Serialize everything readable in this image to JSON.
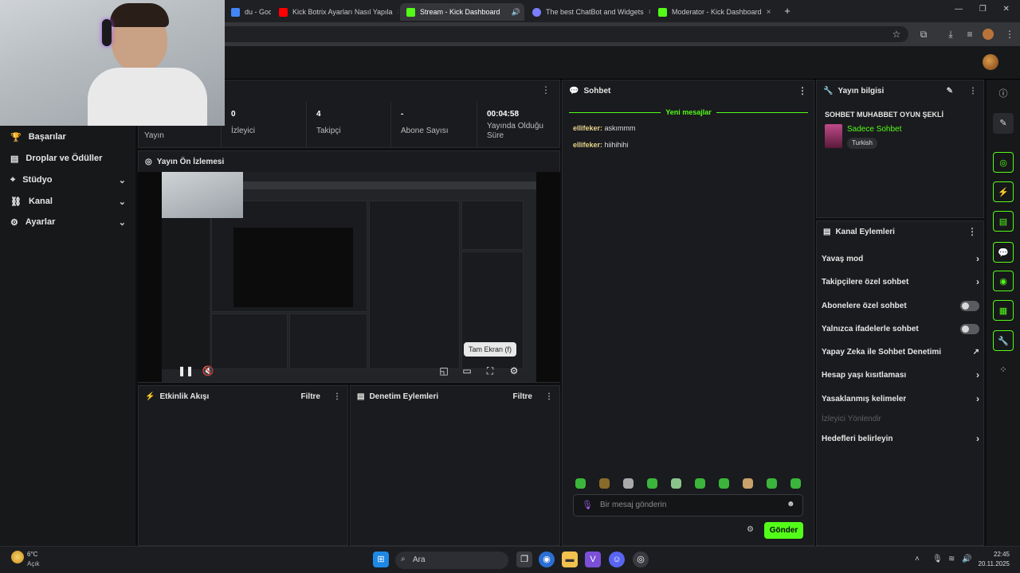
{
  "browser": {
    "tabs": [
      {
        "label": "du - Goog",
        "color": "#4285f4",
        "active": false
      },
      {
        "label": "Kick Botrix Ayarları Nasıl Yapıla",
        "color": "#ff0000",
        "active": false
      },
      {
        "label": "Stream - Kick Dashboard",
        "color": "#53fc18",
        "active": true
      },
      {
        "label": "The best ChatBot and Widgets",
        "color": "#7b7dff",
        "active": false
      },
      {
        "label": "Moderator - Kick Dashboard",
        "color": "#53fc18",
        "active": false
      }
    ],
    "new_tab": "+",
    "close": "×"
  },
  "sidebar": {
    "items": [
      {
        "label": "Başarılar",
        "icon": "trophy-icon"
      },
      {
        "label": "Droplar ve Ödüller",
        "icon": "gift-icon"
      },
      {
        "label": "Stüdyo",
        "icon": "studio-icon",
        "expandable": true
      },
      {
        "label": "Kanal",
        "icon": "channel-icon",
        "expandable": true
      },
      {
        "label": "Ayarlar",
        "icon": "gear-icon",
        "expandable": true
      }
    ]
  },
  "stats": {
    "first_label": "Yayın",
    "items": [
      {
        "value": "0",
        "label": "İzleyici"
      },
      {
        "value": "4",
        "label": "Takipçi"
      },
      {
        "value": "-",
        "label": "Abone Sayısı"
      },
      {
        "value": "00:04:58",
        "label": "Yayında Olduğu Süre"
      }
    ]
  },
  "preview": {
    "title": "Yayın Ön İzlemesi",
    "tooltip": "Tam Ekran (f)"
  },
  "activity": {
    "title": "Etkinlik Akışı",
    "filter": "Filtre"
  },
  "moderation": {
    "title": "Denetim Eylemleri",
    "filter": "Filtre"
  },
  "chat": {
    "title": "Sohbet",
    "new_messages": "Yeni mesajlar",
    "messages": [
      {
        "user": "ellifeker:",
        "text": "askımmm"
      },
      {
        "user": "ellifeker:",
        "text": "hiihihihi"
      }
    ],
    "placeholder": "Bir mesaj gönderin",
    "send": "Gönder"
  },
  "stream_info": {
    "title": "Yayın bilgisi",
    "stream_title": "SOHBET MUHABBET OYUN ŞEKLİ",
    "category": "Sadece Sohbet",
    "language": "Turkish"
  },
  "channel_actions": {
    "title": "Kanal Eylemleri",
    "items": [
      {
        "label": "Yavaş mod",
        "kind": "chevron"
      },
      {
        "label": "Takipçilere özel sohbet",
        "kind": "chevron"
      },
      {
        "label": "Abonelere özel sohbet",
        "kind": "toggle"
      },
      {
        "label": "Yalnızca ifadelerle sohbet",
        "kind": "toggle"
      },
      {
        "label": "Yapay Zeka ile Sohbet Denetimi",
        "kind": "external"
      },
      {
        "label": "Hesap yaşı kısıtlaması",
        "kind": "chevron"
      },
      {
        "label": "Yasaklanmış kelimeler",
        "kind": "chevron"
      },
      {
        "label": "İzleyici Yönlendir",
        "kind": "disabled"
      },
      {
        "label": "Hedefleri belirleyin",
        "kind": "chevron"
      }
    ]
  },
  "taskbar": {
    "weather_temp": "6°C",
    "weather_desc": "Açık",
    "search": "Ara",
    "time": "22:45",
    "date": "20.11.2025"
  },
  "colors": {
    "accent": "#53fc18",
    "panel": "#1a1b1e",
    "background": "#0e0f11"
  }
}
